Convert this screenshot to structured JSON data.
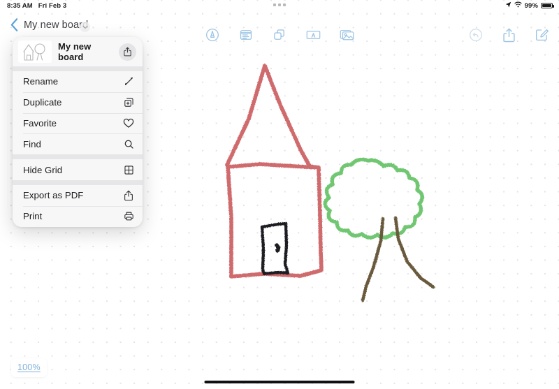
{
  "status_bar": {
    "time": "8:35 AM",
    "date": "Fri Feb 3",
    "battery_percent": "99%",
    "icons": [
      "location-arrow-icon",
      "wifi-icon",
      "battery-icon"
    ]
  },
  "nav_bar": {
    "back_label": "back-chevron-icon",
    "title": "My new board",
    "title_chevron": "chevron-down-icon",
    "center_tools": [
      {
        "name": "markup-tool",
        "icon": "circled-pen-icon"
      },
      {
        "name": "note-tool",
        "icon": "sticky-note-icon"
      },
      {
        "name": "shapes-tool",
        "icon": "overlapping-shapes-icon"
      },
      {
        "name": "text-tool",
        "icon": "text-box-a-icon"
      },
      {
        "name": "media-tool",
        "icon": "photo-stack-icon"
      }
    ],
    "right_tools": [
      {
        "name": "undo-button",
        "icon": "undo-arrow-icon",
        "disabled": true
      },
      {
        "name": "share-button",
        "icon": "share-up-arrow-icon",
        "disabled": false
      },
      {
        "name": "compose-button",
        "icon": "compose-pencil-square-icon",
        "disabled": false
      }
    ]
  },
  "popover": {
    "board_title": "My new board",
    "thumbnail": "board-thumbnail-house-tree",
    "share_icon": "share-up-arrow-icon",
    "groups": [
      {
        "items": [
          {
            "label": "Rename",
            "icon": "pencil-icon"
          },
          {
            "label": "Duplicate",
            "icon": "duplicate-plus-icon"
          },
          {
            "label": "Favorite",
            "icon": "heart-icon"
          },
          {
            "label": "Find",
            "icon": "magnifier-icon"
          }
        ]
      },
      {
        "items": [
          {
            "label": "Hide Grid",
            "icon": "grid-icon"
          }
        ]
      },
      {
        "items": [
          {
            "label": "Export as PDF",
            "icon": "share-up-arrow-icon"
          },
          {
            "label": "Print",
            "icon": "printer-icon"
          }
        ]
      }
    ]
  },
  "canvas": {
    "zoom_level": "100%",
    "grid_visible": true,
    "drawing_objects": [
      {
        "name": "house-sketch",
        "color": "#cc5f63",
        "description": "red house with tall pointed roof"
      },
      {
        "name": "door-sketch",
        "color": "#1e1e20",
        "description": "black door with doorknob"
      },
      {
        "name": "tree-canopy-sketch",
        "color": "#6ac46a",
        "description": "green scalloped tree canopy"
      },
      {
        "name": "tree-trunk-sketch",
        "color": "#6a5a3c",
        "description": "brown splayed trunk"
      }
    ]
  },
  "home_indicator": "home-indicator-bar",
  "colors": {
    "tool_blue": "#9cc4e4",
    "house_red": "#cc5f63",
    "tree_green": "#6ac46a",
    "trunk_brown": "#6a5a3c",
    "link_blue": "#7fb1da"
  }
}
